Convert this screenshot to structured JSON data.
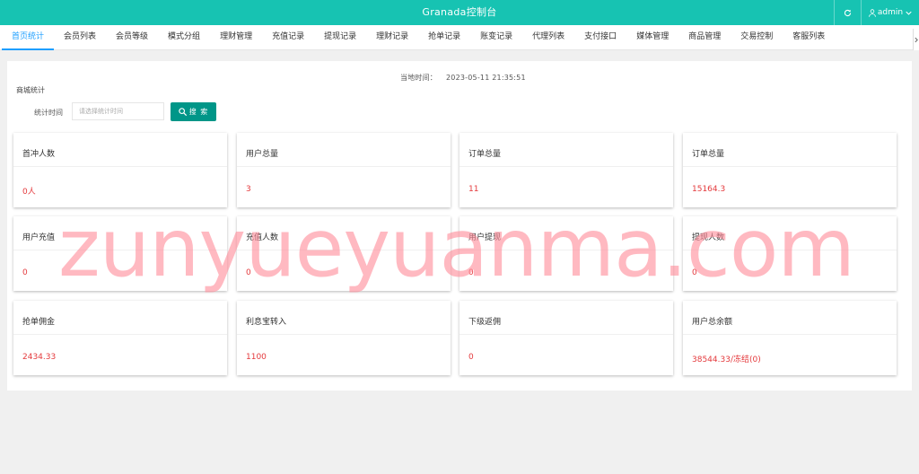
{
  "header": {
    "title": "Granada控制台",
    "user": "admin",
    "refresh_icon": "refresh-icon",
    "user_icon": "user-icon"
  },
  "nav": {
    "tabs": [
      {
        "label": "首页统计",
        "active": true
      },
      {
        "label": "会员列表"
      },
      {
        "label": "会员等级"
      },
      {
        "label": "模式分组"
      },
      {
        "label": "理财管理"
      },
      {
        "label": "充值记录"
      },
      {
        "label": "提现记录"
      },
      {
        "label": "理财记录"
      },
      {
        "label": "抢单记录"
      },
      {
        "label": "账变记录"
      },
      {
        "label": "代理列表"
      },
      {
        "label": "支付接口"
      },
      {
        "label": "媒体管理"
      },
      {
        "label": "商品管理"
      },
      {
        "label": "交易控制"
      },
      {
        "label": "客服列表"
      }
    ]
  },
  "main": {
    "time_label": "当地时间：",
    "time_value": "2023-05-11 21:35:51",
    "section_label": "商城统计",
    "filter": {
      "label": "统计时间",
      "placeholder": "请选择统计时间",
      "button_label": "搜 索"
    },
    "cards": [
      {
        "title": "首冲人数",
        "value": "0人"
      },
      {
        "title": "用户总量",
        "value": "3"
      },
      {
        "title": "订单总量",
        "value": "11"
      },
      {
        "title": "订单总量",
        "value": "15164.3"
      },
      {
        "title": "用户充值",
        "value": "0"
      },
      {
        "title": "充值人数",
        "value": "0"
      },
      {
        "title": "用户提现",
        "value": "0"
      },
      {
        "title": "提现人数",
        "value": "0"
      },
      {
        "title": "抢单佣金",
        "value": "2434.33"
      },
      {
        "title": "利息宝转入",
        "value": "1100"
      },
      {
        "title": "下级返佣",
        "value": "0"
      },
      {
        "title": "用户总余额",
        "value": "38544.33/冻结(0)"
      }
    ]
  },
  "watermark": "zunyueyuanma.com",
  "colors": {
    "header_bg": "#17c3b2",
    "active_tab": "#1e9fff",
    "search_button": "#009688",
    "value_text": "#e4393c",
    "watermark": "#ff8f9c"
  }
}
